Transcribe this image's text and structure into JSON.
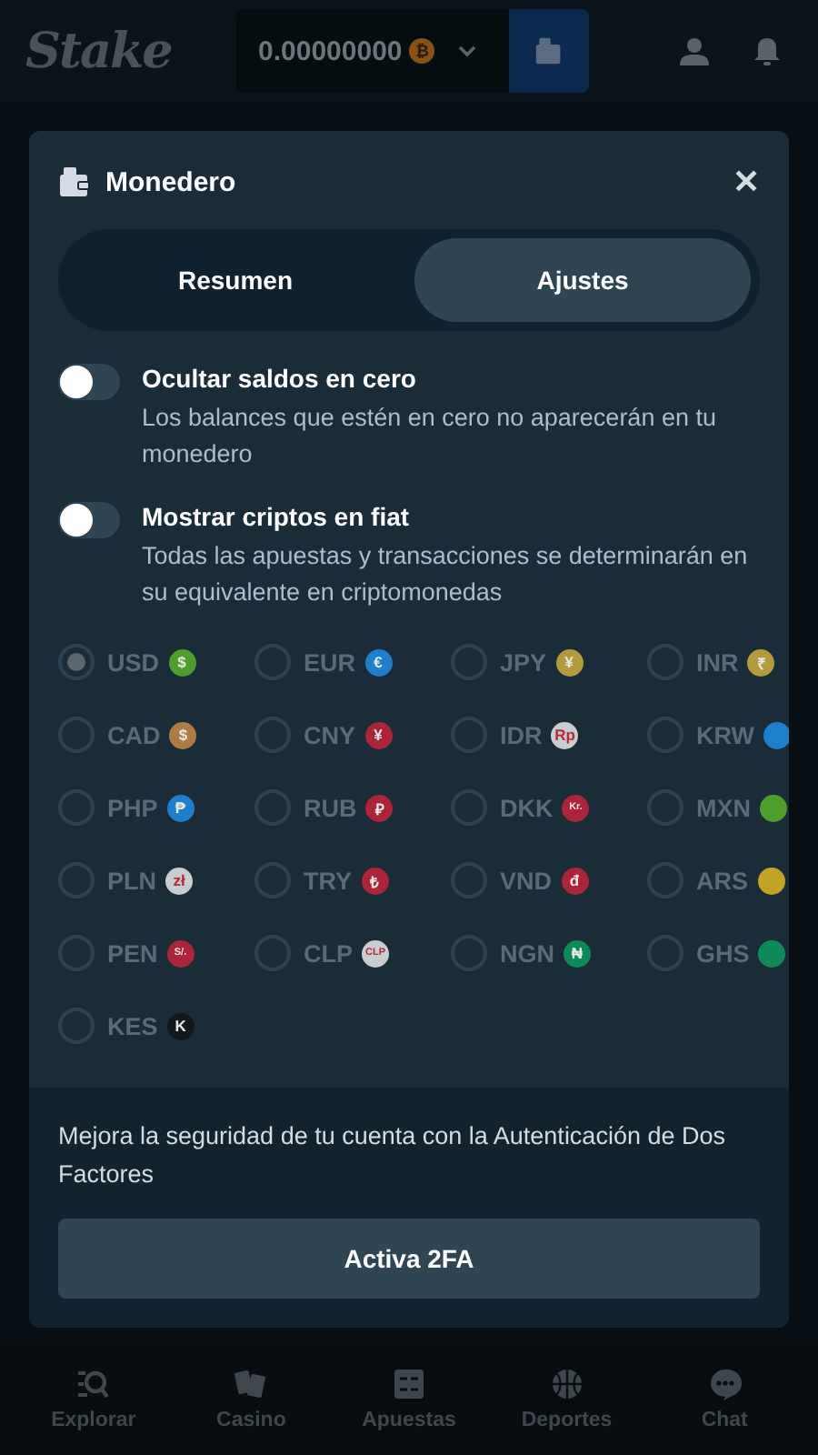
{
  "header": {
    "logo": "Stake",
    "balance": "0.00000000",
    "balance_coin": "₿"
  },
  "modal": {
    "title": "Monedero",
    "close": "✕",
    "tabs": [
      {
        "label": "Resumen",
        "selected": false
      },
      {
        "label": "Ajustes",
        "selected": true
      }
    ],
    "toggles": [
      {
        "title": "Ocultar saldos en cero",
        "description": "Los balances que estén en cero no aparecerán en tu monedero",
        "on": false
      },
      {
        "title": "Mostrar criptos en fiat",
        "description": "Todas las apuestas y transacciones se determinarán en su equivalente en criptomonedas",
        "on": false
      }
    ],
    "currencies": [
      {
        "code": "USD",
        "symbol": "$",
        "color": "#4c9f2a",
        "selected": true
      },
      {
        "code": "EUR",
        "symbol": "€",
        "color": "#1e7fcc",
        "selected": false
      },
      {
        "code": "JPY",
        "symbol": "¥",
        "color": "#b39a3c",
        "selected": false
      },
      {
        "code": "INR",
        "symbol": "₹",
        "color": "#b39a3c",
        "selected": false
      },
      {
        "code": "CAD",
        "symbol": "$",
        "color": "#b07a45",
        "selected": false
      },
      {
        "code": "CNY",
        "symbol": "¥",
        "color": "#ad2339",
        "selected": false
      },
      {
        "code": "IDR",
        "symbol": "Rp",
        "color": "#c9ccd1",
        "selected": false
      },
      {
        "code": "KRW",
        "color": "#1e7fcc",
        "selected": false
      },
      {
        "code": "PHP",
        "symbol": "₱",
        "color": "#1e7fcc",
        "selected": false
      },
      {
        "code": "RUB",
        "symbol": "₽",
        "color": "#ad2339",
        "selected": false
      },
      {
        "code": "DKK",
        "symbol": "Kr.",
        "color": "#ad2339",
        "selected": false
      },
      {
        "code": "MXN",
        "color": "#4c9f2a",
        "selected": false
      },
      {
        "code": "PLN",
        "symbol": "zł",
        "color": "#c9ccd1",
        "selected": false
      },
      {
        "code": "TRY",
        "symbol": "₺",
        "color": "#ad2339",
        "selected": false
      },
      {
        "code": "VND",
        "symbol": "đ",
        "color": "#ad2339",
        "selected": false
      },
      {
        "code": "ARS",
        "color": "#c2a324",
        "selected": false
      },
      {
        "code": "PEN",
        "symbol": "S/.",
        "color": "#ad2339",
        "selected": false
      },
      {
        "code": "CLP",
        "symbol": "CLP",
        "color": "#c9ccd1",
        "selected": false
      },
      {
        "code": "NGN",
        "symbol": "₦",
        "color": "#0e8a5a",
        "selected": false
      },
      {
        "code": "GHS",
        "color": "#0e8a5a",
        "selected": false
      },
      {
        "code": "KES",
        "symbol": "K",
        "color": "#12181c",
        "selected": false
      }
    ],
    "security_text": "Mejora la seguridad de tu cuenta con la Autenticación de Dos Factores",
    "security_button": "Activa 2FA"
  },
  "bottom_nav": [
    {
      "label": "Explorar",
      "kind": "explore"
    },
    {
      "label": "Casino",
      "kind": "cards"
    },
    {
      "label": "Apuestas",
      "kind": "slip"
    },
    {
      "label": "Deportes",
      "kind": "ball"
    },
    {
      "label": "Chat",
      "kind": "chat"
    }
  ]
}
